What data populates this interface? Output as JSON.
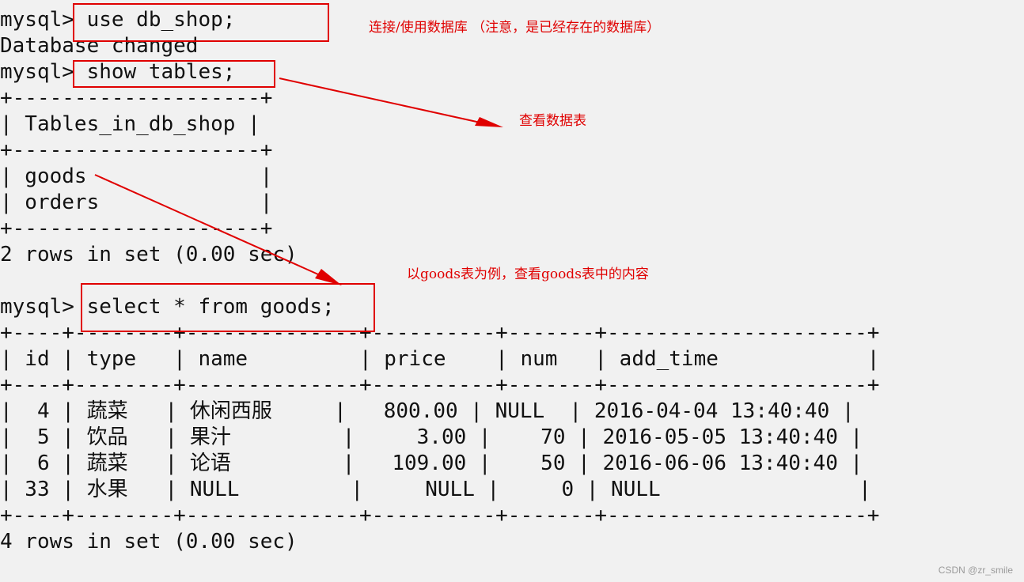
{
  "terminal": {
    "lines": [
      "mysql> use db_shop;",
      "Database changed",
      "mysql> show tables;",
      "+--------------------+",
      "| Tables_in_db_shop |",
      "+--------------------+",
      "| goods              |",
      "| orders             |",
      "+--------------------+",
      "2 rows in set (0.00 sec)",
      "",
      "mysql> select * from goods;",
      "+----+--------+--------------+----------+-------+---------------------+",
      "| id | type   | name         | price    | num   | add_time            |",
      "+----+--------+--------------+----------+-------+---------------------+",
      "|  4 | 蔬菜   | 休闲西服     |   800.00 | NULL  | 2016-04-04 13:40:40 |",
      "|  5 | 饮品   | 果汁         |     3.00 |    70 | 2016-05-05 13:40:40 |",
      "|  6 | 蔬菜   | 论语         |   109.00 |    50 | 2016-06-06 13:40:40 |",
      "| 33 | 水果   | NULL         |     NULL |     0 | NULL                |",
      "+----+--------+--------------+----------+-------+---------------------+",
      "4 rows in set (0.00 sec)"
    ]
  },
  "annotations": {
    "use_db": "连接/使用数据库  （注意，是已经存在的数据库）",
    "show_tables": "查看数据表",
    "select_goods": "以goods表为例，查看goods表中的内容"
  },
  "colors": {
    "annotation": "#e00000",
    "background": "#f1f1f1",
    "text": "#111111"
  },
  "watermark": "CSDN @zr_smile"
}
